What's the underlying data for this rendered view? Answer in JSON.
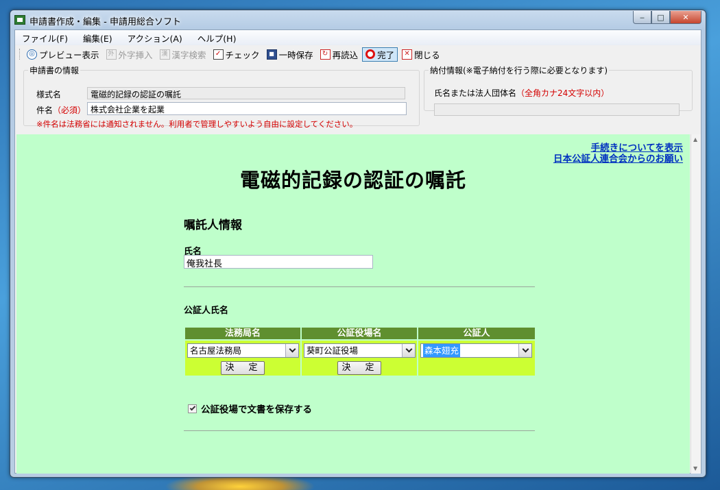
{
  "window": {
    "title": "申請書作成・編集 - 申請用総合ソフト",
    "buttons": {
      "minimize": "‒",
      "maximize": "□",
      "close": "✕"
    }
  },
  "menu": [
    "ファイル(F)",
    "編集(E)",
    "アクション(A)",
    "ヘルプ(H)"
  ],
  "toolbar": {
    "preview": "プレビュー表示",
    "gaiji": "外字挿入",
    "kanji": "漢字検索",
    "check": "チェック",
    "temp_save": "一時保存",
    "reload": "再読込",
    "done": "完了",
    "close": "閉じる",
    "icons": {
      "gaiji": "外",
      "kanji": "漢",
      "check": "✓",
      "save": "■",
      "reload": "↻",
      "close": "✕"
    }
  },
  "application_info": {
    "legend": "申請書の情報",
    "form_name_label": "様式名",
    "form_name_value": "電磁的記録の認証の嘱託",
    "subject_label": "件名",
    "subject_required": "（必須）",
    "subject_value": "株式会社企業を起業",
    "note": "※件名は法務省には通知されません。利用者で管理しやすいよう自由に設定してください。"
  },
  "payment_info": {
    "legend": "納付情報(※電子納付を行う際に必要となります)",
    "name_label": "氏名または法人団体名",
    "name_hint": "（全角カナ24文字以内）",
    "name_value": ""
  },
  "form": {
    "links": {
      "procedure": "手続きについてを表示",
      "association": "日本公証人連合会からのお願い"
    },
    "title": "電磁的記録の認証の嘱託",
    "section_title": "嘱託人情報",
    "name_label": "氏名",
    "name_value": "俺我社長",
    "notary_label": "公証人氏名",
    "columns": [
      {
        "header": "法務局名",
        "selected": "名古屋法務局",
        "button": "決　定"
      },
      {
        "header": "公証役場名",
        "selected": "葵町公証役場",
        "button": "決　定"
      },
      {
        "header": "公証人",
        "selected": "森本翅充"
      }
    ],
    "save_checkbox": {
      "label": "公証役場で文書を保存する",
      "checked": true
    }
  },
  "colors": {
    "content_bg": "#bfffcb",
    "table_header": "#5f8f2f",
    "table_cell": "#ccff33",
    "required_red": "#d40000",
    "link_blue": "#0030c0",
    "selection": "#3399ff"
  }
}
